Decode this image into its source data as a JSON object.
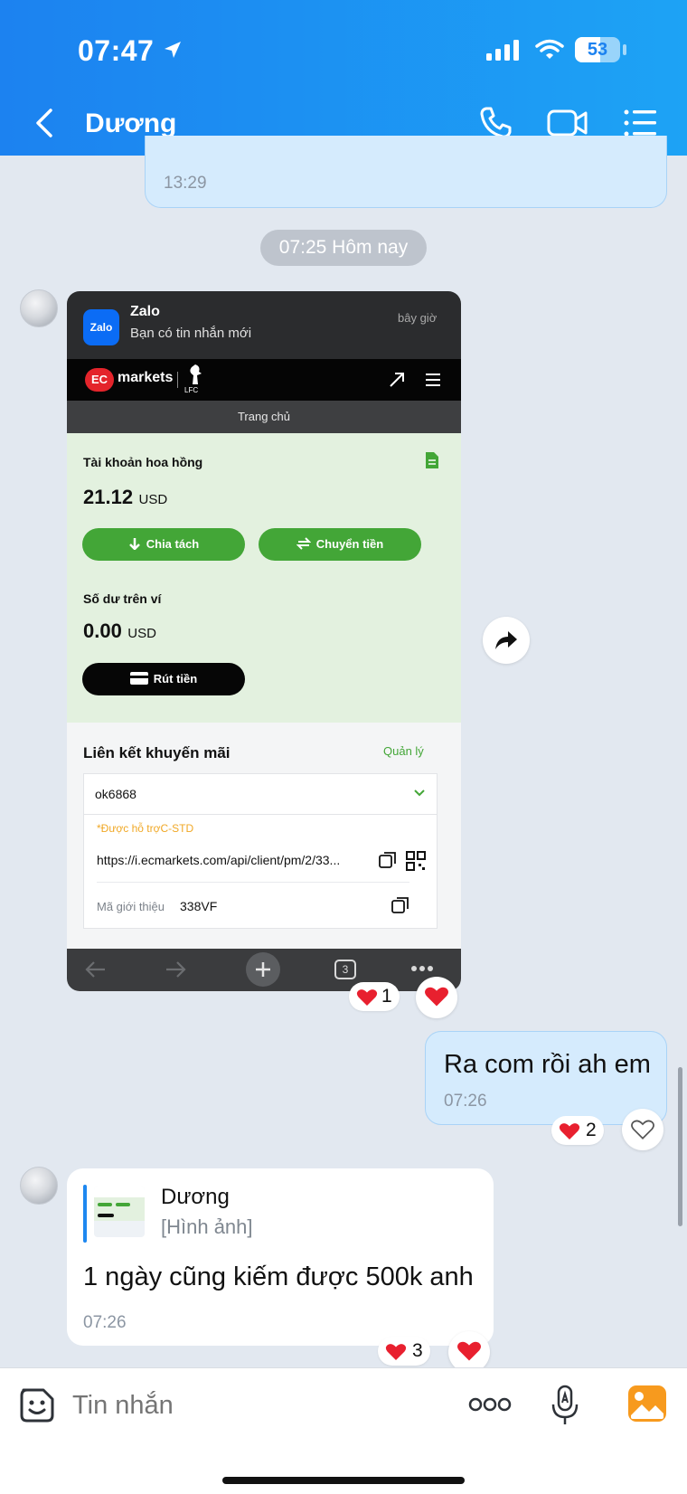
{
  "status_bar": {
    "time": "07:47",
    "battery": "53"
  },
  "header": {
    "contact_name": "Dương"
  },
  "messages": {
    "prev_out_time": "13:29",
    "date_divider": "07:25 Hôm nay",
    "screenshot": {
      "notification": {
        "app": "Zalo",
        "text": "Bạn có tin nhắn mới",
        "when": "bây giờ",
        "logo_text": "Zalo"
      },
      "site": {
        "brand_ec": "EC",
        "brand_markets": "markets",
        "partner": "LFC",
        "home_label": "Trang chủ"
      },
      "commission": {
        "label": "Tài khoản hoa hồng",
        "amount": "21.12",
        "currency": "USD",
        "split_button": "Chia tách",
        "transfer_button": "Chuyển tiền"
      },
      "wallet": {
        "label": "Số dư trên ví",
        "amount": "0.00",
        "currency": "USD",
        "withdraw_button": "Rút tiền"
      },
      "promo": {
        "title": "Liên kết khuyến mãi",
        "manage": "Quản lý",
        "account": "ok6868",
        "note": "*Được hỗ trợC-STD",
        "link": "https://i.ecmarkets.com/api/client/pm/2/33...",
        "ref_label": "Mã giới thiệu",
        "ref_code": "338VF"
      },
      "browser": {
        "tab_count": "3"
      },
      "reaction_count": "1"
    },
    "out_msg": {
      "text": "Ra com rồi ah em",
      "time": "07:26",
      "reaction_count": "2"
    },
    "reply_msg": {
      "quoted_name": "Dương",
      "quoted_type": "[Hình ảnh]",
      "text": "1 ngày cũng kiếm được 500k anh",
      "time": "07:26",
      "reaction_count": "3"
    }
  },
  "composer": {
    "placeholder": "Tin nhắn"
  },
  "colors": {
    "header_gradient_start": "#1c82f0",
    "header_gradient_end": "#1da3f5",
    "outgoing_bubble": "#d5ebfd",
    "chat_background": "#e2e8f0",
    "heart": "#e8202f",
    "ec_green": "#43a637"
  }
}
